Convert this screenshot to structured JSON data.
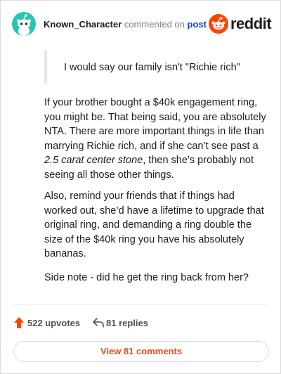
{
  "comment": {
    "username": "Known_Character",
    "action_text": "commented on",
    "post_link": "post",
    "quote": "I would say our family isn't \"Richie rich\"",
    "paragraphs": {
      "p1_before": "If your brother bought a $40k engagement ring, you might be. That being said, you are absolutely NTA. There are more important things in life than marrying Richie rich, and if she can’t see past a ",
      "p1_italic": "2.5 carat center stone",
      "p1_after": ", then she’s probably not seeing all those other things.",
      "p2": "Also, remind your friends that if things had worked out, she’d have a lifetime to upgrade that original ring, and demanding a ring double the size of the $40k ring you have his absolutely bananas.",
      "p3": "Side note - did he get the ring back from her?"
    }
  },
  "brand": {
    "name": "reddit",
    "color": "#ff4500"
  },
  "stats": {
    "upvotes": "522 upvotes",
    "replies": "81 replies"
  },
  "view_button": "View 81 comments",
  "icons": {
    "avatar": "snoo-avatar-icon",
    "logo": "reddit-logo-icon",
    "upvote": "upvote-arrow-icon",
    "reply": "reply-arrow-icon"
  },
  "colors": {
    "accent": "#ff4500",
    "link": "#1a3cd4",
    "avatar_bg": "#24c8b0"
  }
}
